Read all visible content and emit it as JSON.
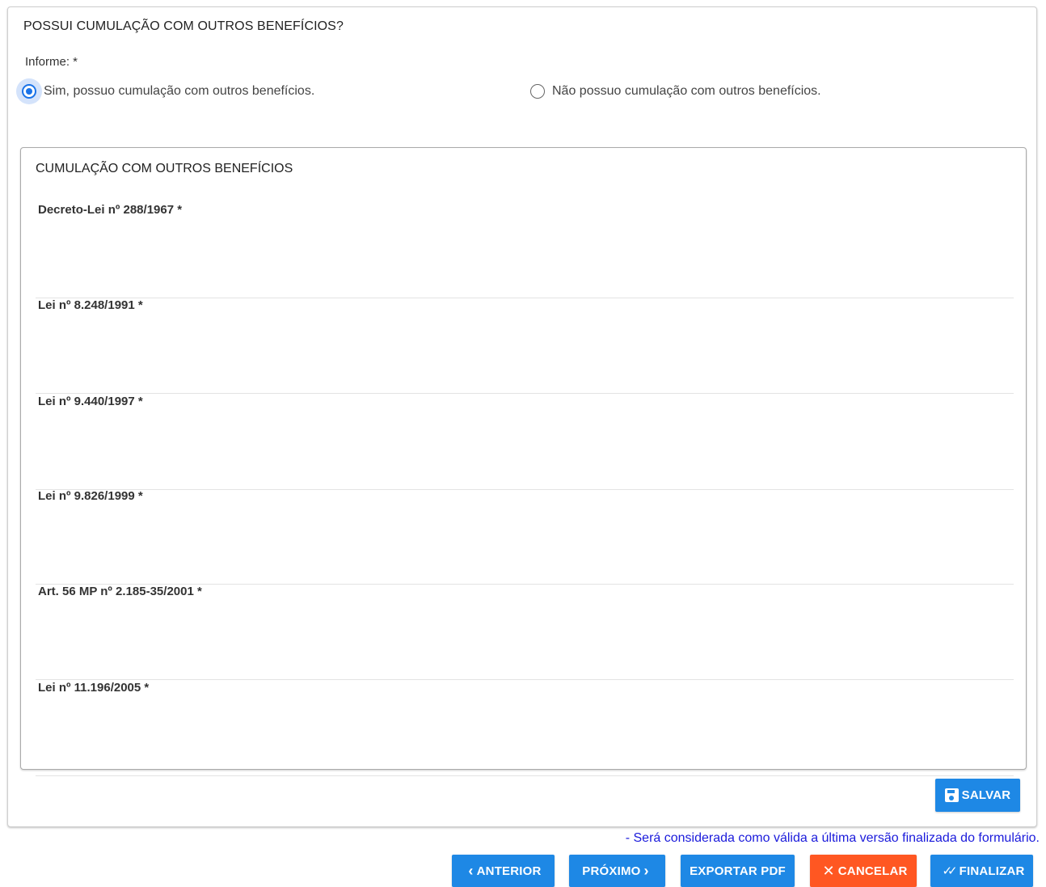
{
  "question": {
    "title": "POSSUI CUMULAÇÃO COM OUTROS BENEFÍCIOS?",
    "informe_label": "Informe: *",
    "options": [
      {
        "label": "Sim, possuo cumulação com outros benefícios.",
        "selected": true
      },
      {
        "label": "Não possuo cumulação com outros benefícios.",
        "selected": false
      }
    ]
  },
  "cumulacao": {
    "title": "CUMULAÇÃO COM OUTROS BENEFÍCIOS",
    "fields": [
      {
        "label": "Decreto-Lei nº 288/1967 *",
        "value": ""
      },
      {
        "label": "Lei nº 8.248/1991 *",
        "value": ""
      },
      {
        "label": "Lei nº 9.440/1997 *",
        "value": ""
      },
      {
        "label": "Lei nº 9.826/1999 *",
        "value": ""
      },
      {
        "label": "Art. 56 MP nº 2.185-35/2001 *",
        "value": ""
      },
      {
        "label": "Lei nº 11.196/2005 *",
        "value": ""
      }
    ]
  },
  "actions": {
    "save_label": "SALVAR",
    "notice": "- Será considerada como válida a última versão finalizada do formulário.",
    "previous_label": "ANTERIOR",
    "next_label": "PRÓXIMO",
    "export_label": "EXPORTAR PDF",
    "cancel_label": "CANCELAR",
    "finish_label": "FINALIZAR"
  },
  "colors": {
    "primary": "#1e88e5",
    "danger": "#ff5722",
    "notice_text": "#1a1adb"
  },
  "icons": [
    "radio-checked-icon",
    "radio-unchecked-icon",
    "save-icon",
    "chevron-left-icon",
    "chevron-right-icon",
    "close-icon",
    "double-check-icon"
  ]
}
